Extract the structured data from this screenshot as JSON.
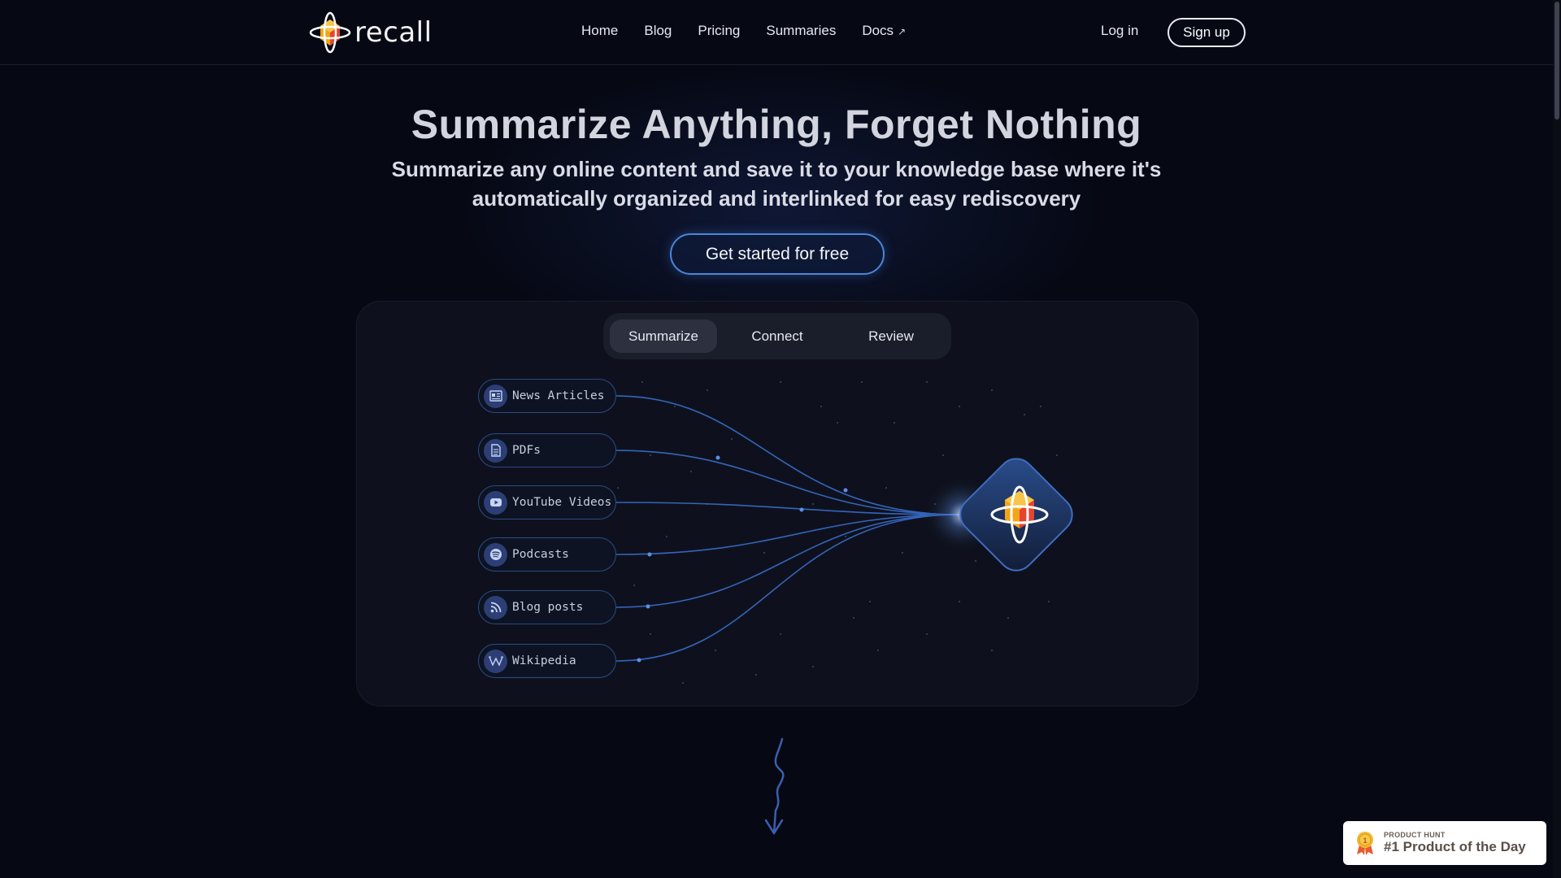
{
  "brand": {
    "name": "recall"
  },
  "nav": {
    "links": [
      "Home",
      "Blog",
      "Pricing",
      "Summaries",
      "Docs"
    ],
    "external_mark": "↗",
    "login": "Log in",
    "signup": "Sign up"
  },
  "hero": {
    "title": "Summarize Anything, Forget Nothing",
    "subtitle_line1": "Summarize any online content and save it to your knowledge base where it's",
    "subtitle_line2": "automatically organized and interlinked for easy rediscovery",
    "cta": "Get started for free"
  },
  "tabs": [
    {
      "label": "Summarize",
      "active": true
    },
    {
      "label": "Connect",
      "active": false
    },
    {
      "label": "Review",
      "active": false
    }
  ],
  "sources": [
    {
      "label": "News Articles",
      "icon": "newspaper-icon"
    },
    {
      "label": "PDFs",
      "icon": "document-icon"
    },
    {
      "label": "YouTube Videos",
      "icon": "youtube-icon"
    },
    {
      "label": "Podcasts",
      "icon": "spotify-icon"
    },
    {
      "label": "Blog posts",
      "icon": "rss-icon"
    },
    {
      "label": "Wikipedia",
      "icon": "wikipedia-icon"
    }
  ],
  "product_hunt": {
    "small": "PRODUCT HUNT",
    "big": "#1 Product of the Day"
  },
  "colors": {
    "background": "#060914",
    "accent": "#4a86d8",
    "line": "#3b73d6",
    "logo_orange": "#f2a516",
    "logo_red": "#e8432f"
  }
}
